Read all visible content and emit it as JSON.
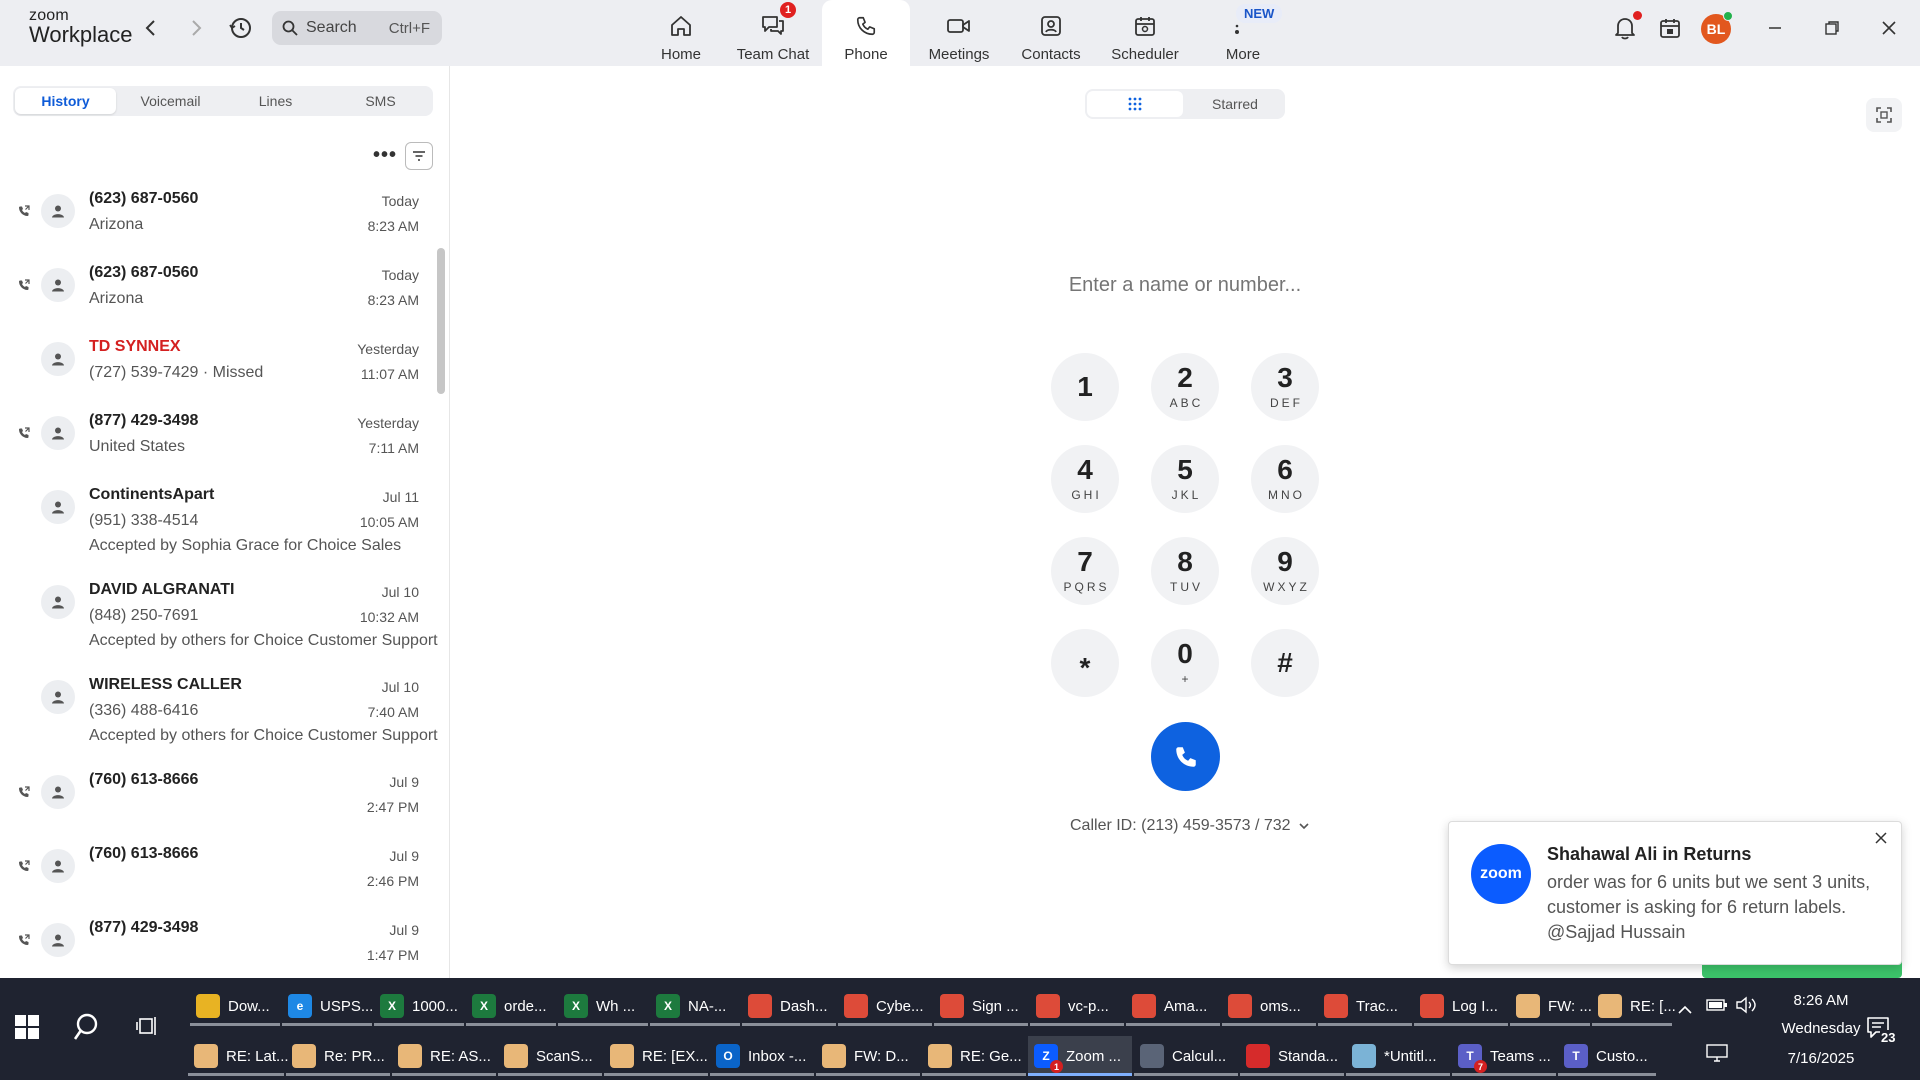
{
  "app": {
    "logo_line1": "zoom",
    "logo_line2": "Workplace"
  },
  "search": {
    "placeholder": "Search",
    "shortcut": "Ctrl+F"
  },
  "nav": [
    {
      "label": "Home",
      "icon": "home-icon"
    },
    {
      "label": "Team Chat",
      "icon": "chat-icon",
      "badge": "1"
    },
    {
      "label": "Phone",
      "icon": "phone-icon",
      "active": true
    },
    {
      "label": "Meetings",
      "icon": "video-icon"
    },
    {
      "label": "Contacts",
      "icon": "contacts-icon"
    },
    {
      "label": "Scheduler",
      "icon": "calendar-icon"
    },
    {
      "label": "More",
      "icon": "more-icon"
    }
  ],
  "new_badge": "NEW",
  "user": {
    "initials": "BL"
  },
  "tabs": [
    "History",
    "Voicemail",
    "Lines",
    "SMS"
  ],
  "calls": [
    {
      "name": "(623) 687-0560",
      "sub": "Arizona",
      "sub2": "",
      "date": "Today",
      "time": "8:23 AM",
      "arrow": true,
      "missed": false
    },
    {
      "name": "(623) 687-0560",
      "sub": "Arizona",
      "sub2": "",
      "date": "Today",
      "time": "8:23 AM",
      "arrow": true,
      "missed": false
    },
    {
      "name": "TD SYNNEX",
      "sub": "(727) 539-7429 · Missed",
      "sub2": "",
      "date": "Yesterday",
      "time": "11:07 AM",
      "arrow": false,
      "missed": true
    },
    {
      "name": "(877) 429-3498",
      "sub": "United States",
      "sub2": "",
      "date": "Yesterday",
      "time": "7:11 AM",
      "arrow": true,
      "missed": false
    },
    {
      "name": "ContinentsApart",
      "sub": "(951) 338-4514",
      "sub2": "Accepted by Sophia Grace for Choice Sales",
      "date": "Jul 11",
      "time": "10:05 AM",
      "arrow": false,
      "missed": false
    },
    {
      "name": "DAVID ALGRANATI",
      "sub": "(848) 250-7691",
      "sub2": "Accepted by others for Choice Customer Support",
      "date": "Jul 10",
      "time": "10:32 AM",
      "arrow": false,
      "missed": false
    },
    {
      "name": "WIRELESS CALLER",
      "sub": "(336) 488-6416",
      "sub2": "Accepted by others for Choice Customer Support",
      "date": "Jul 10",
      "time": "7:40 AM",
      "arrow": false,
      "missed": false
    },
    {
      "name": "(760) 613-8666",
      "sub": "",
      "sub2": "",
      "date": "Jul 9",
      "time": "2:47 PM",
      "arrow": true,
      "missed": false
    },
    {
      "name": "(760) 613-8666",
      "sub": "",
      "sub2": "",
      "date": "Jul 9",
      "time": "2:46 PM",
      "arrow": true,
      "missed": false
    },
    {
      "name": "(877) 429-3498",
      "sub": "",
      "sub2": "",
      "date": "Jul 9",
      "time": "1:47 PM",
      "arrow": true,
      "missed": false
    }
  ],
  "dialer": {
    "seg_starred": "Starred",
    "placeholder": "Enter a name or number...",
    "keys": [
      {
        "d": "1",
        "a": ""
      },
      {
        "d": "2",
        "a": "ABC"
      },
      {
        "d": "3",
        "a": "DEF"
      },
      {
        "d": "4",
        "a": "GHI"
      },
      {
        "d": "5",
        "a": "JKL"
      },
      {
        "d": "6",
        "a": "MNO"
      },
      {
        "d": "7",
        "a": "PQRS"
      },
      {
        "d": "8",
        "a": "TUV"
      },
      {
        "d": "9",
        "a": "WXYZ"
      },
      {
        "d": "*",
        "a": ""
      },
      {
        "d": "0",
        "a": "+"
      },
      {
        "d": "#",
        "a": ""
      }
    ],
    "caller_id": "Caller ID: (213) 459-3573 / 732"
  },
  "toast": {
    "logo": "zoom",
    "title": "Shahawal Ali in Returns",
    "message": "order was for 6 units but we sent 3 units, customer is asking for 6 return labels. @Sajjad Hussain"
  },
  "taskbar": {
    "row1": [
      {
        "label": "Dow...",
        "color": "#e8b323",
        "glyph": ""
      },
      {
        "label": "USPS...",
        "color": "#1e88e5",
        "glyph": "e"
      },
      {
        "label": "1000...",
        "color": "#1d7a3e",
        "glyph": "X"
      },
      {
        "label": "orde...",
        "color": "#1d7a3e",
        "glyph": "X"
      },
      {
        "label": "Wh ...",
        "color": "#1d7a3e",
        "glyph": "X"
      },
      {
        "label": "NA-...",
        "color": "#1d7a3e",
        "glyph": "X"
      },
      {
        "label": "Dash...",
        "color": "#dd4b39",
        "glyph": ""
      },
      {
        "label": "Cybe...",
        "color": "#dd4b39",
        "glyph": ""
      },
      {
        "label": "Sign ...",
        "color": "#dd4b39",
        "glyph": ""
      },
      {
        "label": "vc-p...",
        "color": "#dd4b39",
        "glyph": ""
      },
      {
        "label": "Ama...",
        "color": "#dd4b39",
        "glyph": ""
      },
      {
        "label": "oms...",
        "color": "#dd4b39",
        "glyph": ""
      },
      {
        "label": "Trac...",
        "color": "#dd4b39",
        "glyph": ""
      },
      {
        "label": "Log I...",
        "color": "#dd4b39",
        "glyph": ""
      },
      {
        "label": "FW: ...",
        "color": "#e8b778",
        "glyph": ""
      },
      {
        "label": "RE: [...",
        "color": "#e8b778",
        "glyph": ""
      }
    ],
    "row2": [
      {
        "label": "RE: Lat...",
        "color": "#e8b778",
        "glyph": ""
      },
      {
        "label": "Re: PR...",
        "color": "#e8b778",
        "glyph": ""
      },
      {
        "label": "RE: AS...",
        "color": "#e8b778",
        "glyph": ""
      },
      {
        "label": "ScanS...",
        "color": "#e8b778",
        "glyph": ""
      },
      {
        "label": "RE: [EX...",
        "color": "#e8b778",
        "glyph": ""
      },
      {
        "label": "Inbox -...",
        "color": "#0a64c8",
        "glyph": "O"
      },
      {
        "label": "FW: D...",
        "color": "#e8b778",
        "glyph": ""
      },
      {
        "label": "RE: Ge...",
        "color": "#e8b778",
        "glyph": ""
      },
      {
        "label": "Zoom ...",
        "color": "#0b5cff",
        "glyph": "Z",
        "badge": "1",
        "active": true
      },
      {
        "label": "Calcul...",
        "color": "#5a6477",
        "glyph": ""
      },
      {
        "label": "Standa...",
        "color": "#d62b2b",
        "glyph": ""
      },
      {
        "label": "*Untitl...",
        "color": "#7bb3d6",
        "glyph": ""
      },
      {
        "label": "Teams ...",
        "color": "#5b5fc7",
        "glyph": "T",
        "badge": "7"
      },
      {
        "label": "Custo...",
        "color": "#5b5fc7",
        "glyph": "T"
      }
    ],
    "clock_time": "8:26 AM",
    "clock_day": "Wednesday",
    "clock_date": "7/16/2025",
    "notif_count": "23"
  }
}
